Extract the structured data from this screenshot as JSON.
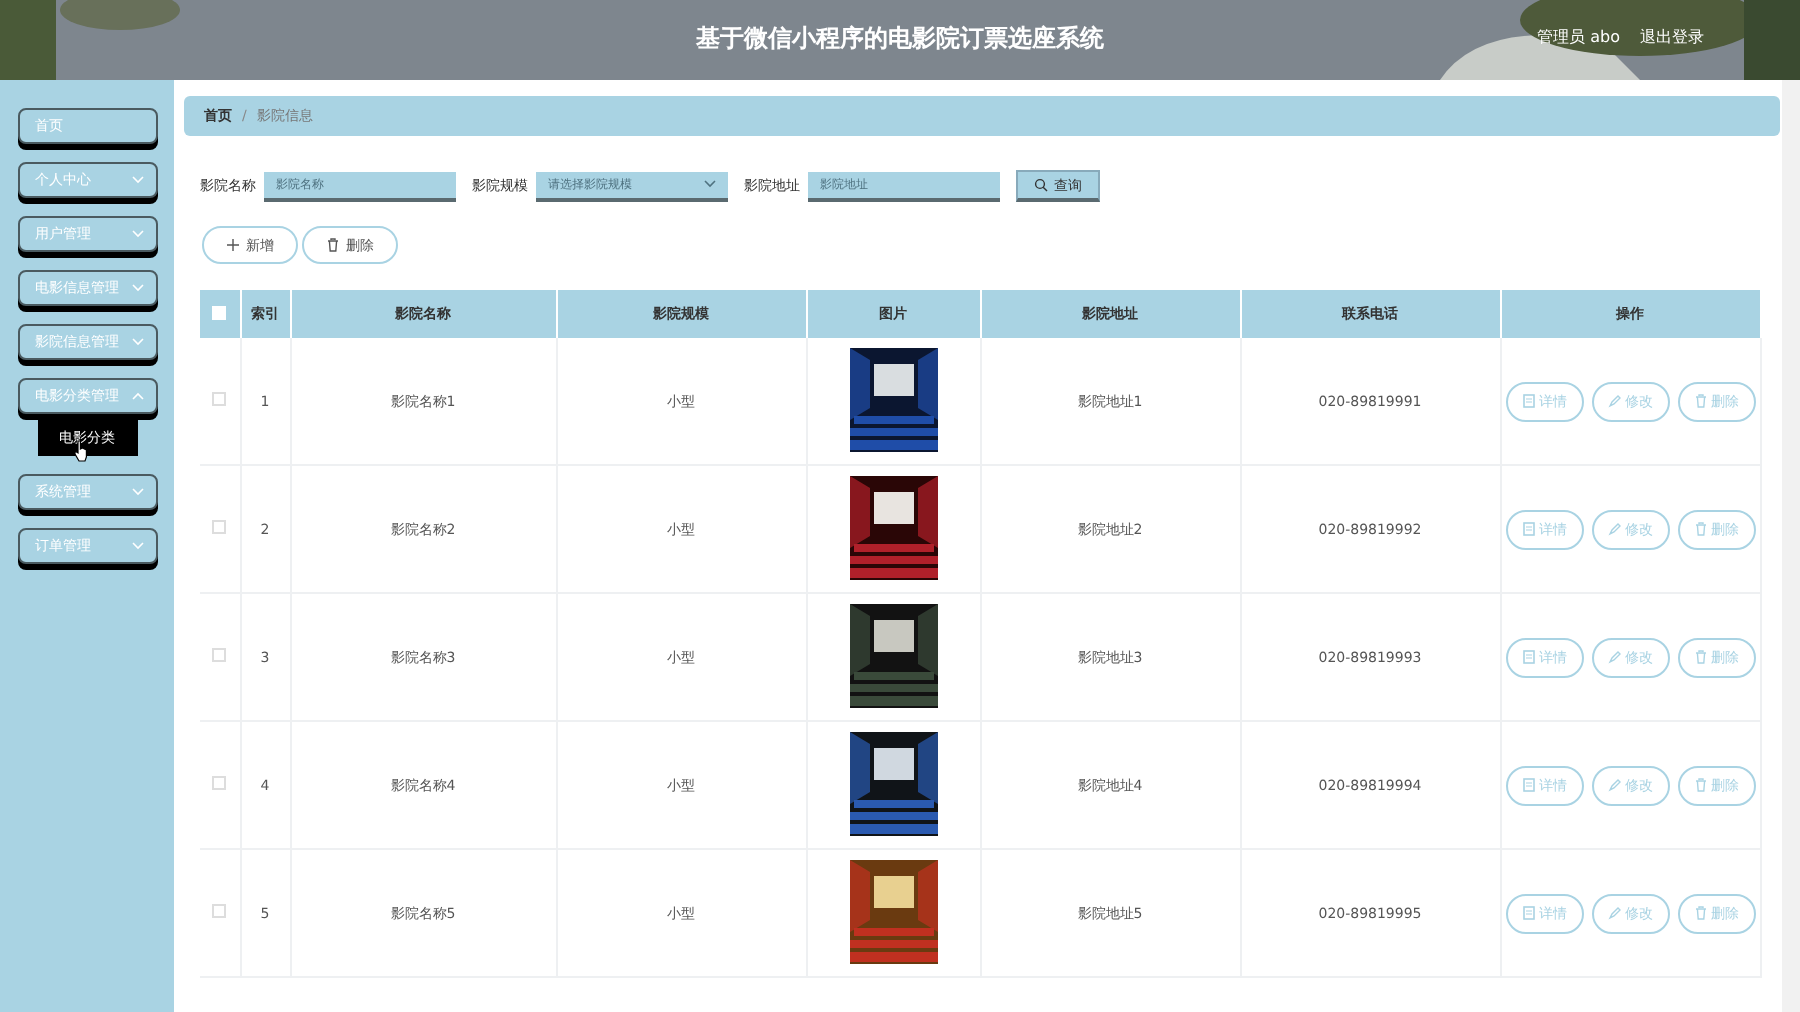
{
  "header": {
    "title": "基于微信小程序的电影院订票选座系统",
    "user": "管理员 abo",
    "logout": "退出登录"
  },
  "sidebar": {
    "items": [
      {
        "label": "首页",
        "kind": "link"
      },
      {
        "label": "个人中心",
        "kind": "menu",
        "expanded": false
      },
      {
        "label": "用户管理",
        "kind": "menu",
        "expanded": false
      },
      {
        "label": "电影信息管理",
        "kind": "menu",
        "expanded": false
      },
      {
        "label": "影院信息管理",
        "kind": "menu",
        "expanded": false
      },
      {
        "label": "电影分类管理",
        "kind": "menu",
        "expanded": true,
        "children": [
          {
            "label": "电影分类",
            "selected": true
          }
        ]
      },
      {
        "label": "系统管理",
        "kind": "menu",
        "expanded": false
      },
      {
        "label": "订单管理",
        "kind": "menu",
        "expanded": false
      }
    ]
  },
  "breadcrumb": {
    "home": "首页",
    "separator": "/",
    "current": "影院信息"
  },
  "search": {
    "fields": [
      {
        "label": "影院名称",
        "placeholder": "影院名称",
        "kind": "text"
      },
      {
        "label": "影院规模",
        "placeholder": "请选择影院规模",
        "kind": "select"
      },
      {
        "label": "影院地址",
        "placeholder": "影院地址",
        "kind": "text"
      }
    ],
    "button": "查询"
  },
  "actions": [
    "新增",
    "删除"
  ],
  "table": {
    "select_all_checked": false,
    "columns": [
      "索引",
      "影院名称",
      "影院规模",
      "图片",
      "影院地址",
      "联系电话",
      "操作"
    ],
    "rows": [
      {
        "checked": false,
        "index": "1",
        "name": "影院名称1",
        "scale": "小型",
        "address": "影院地址1",
        "phone": "020-89819991",
        "actions": [
          "详情",
          "修改",
          "删除"
        ]
      },
      {
        "checked": false,
        "index": "2",
        "name": "影院名称2",
        "scale": "小型",
        "address": "影院地址2",
        "phone": "020-89819992",
        "actions": [
          "详情",
          "修改",
          "删除"
        ]
      },
      {
        "checked": false,
        "index": "3",
        "name": "影院名称3",
        "scale": "小型",
        "address": "影院地址3",
        "phone": "020-89819993",
        "actions": [
          "详情",
          "修改",
          "删除"
        ]
      },
      {
        "checked": false,
        "index": "4",
        "name": "影院名称4",
        "scale": "小型",
        "address": "影院地址4",
        "phone": "020-89819994",
        "actions": [
          "详情",
          "修改",
          "删除"
        ]
      },
      {
        "checked": false,
        "index": "5",
        "name": "影院名称5",
        "scale": "小型",
        "address": "影院地址5",
        "phone": "020-89819995",
        "actions": [
          "详情",
          "修改",
          "删除"
        ]
      }
    ]
  }
}
